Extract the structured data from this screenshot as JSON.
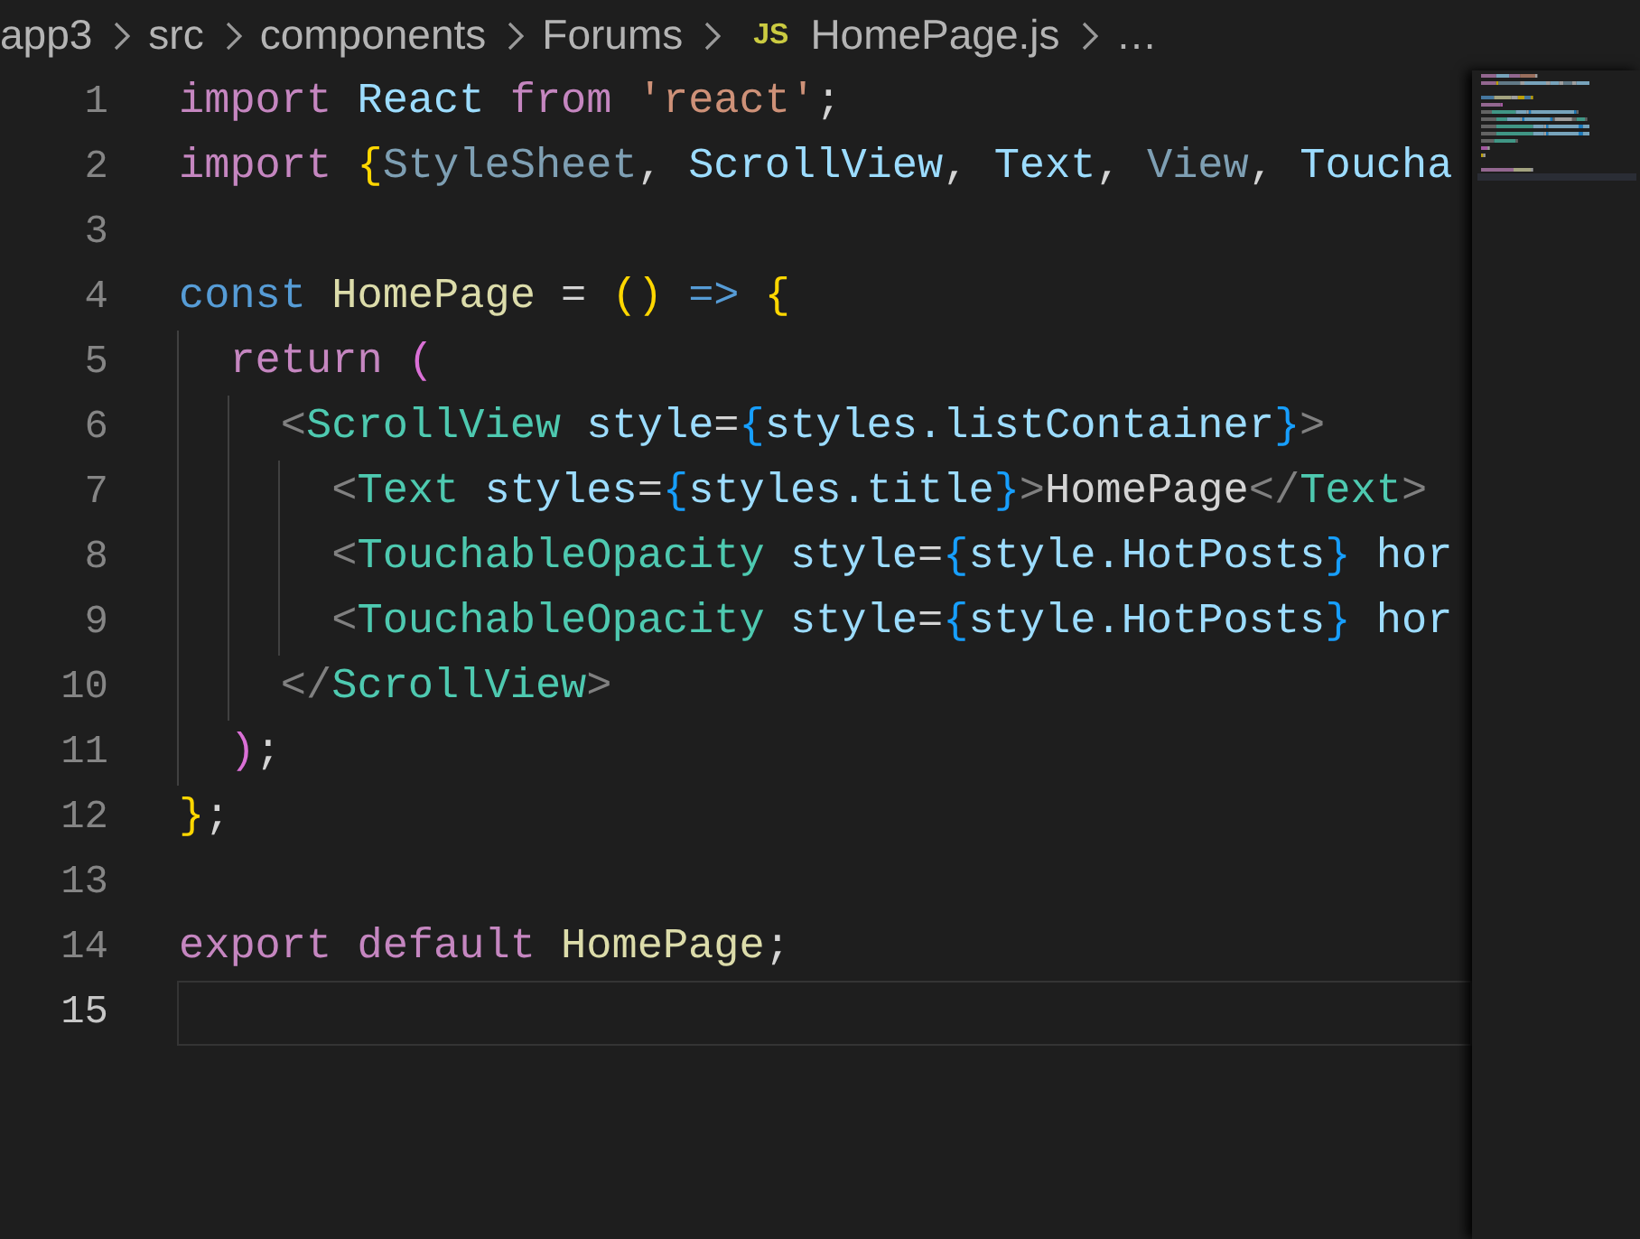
{
  "breadcrumb": [
    {
      "label": "app3"
    },
    {
      "label": "src"
    },
    {
      "label": "components"
    },
    {
      "label": "Forums"
    },
    {
      "label": "HomePage.js",
      "file_badge": "JS"
    },
    {
      "label": "…"
    }
  ],
  "lines": [
    {
      "number": "1",
      "current": false,
      "tokens": [
        {
          "kind": "keyword",
          "text": "import "
        },
        {
          "kind": "variable",
          "text": "React "
        },
        {
          "kind": "keyword",
          "text": "from "
        },
        {
          "kind": "string",
          "text": "'react'"
        },
        {
          "kind": "plain",
          "text": ";"
        }
      ]
    },
    {
      "number": "2",
      "current": false,
      "tokens": [
        {
          "kind": "keyword",
          "text": "import "
        },
        {
          "kind": "brace1",
          "text": "{"
        },
        {
          "kind": "unused",
          "text": "StyleSheet"
        },
        {
          "kind": "plain",
          "text": ", "
        },
        {
          "kind": "variable",
          "text": "ScrollView"
        },
        {
          "kind": "plain",
          "text": ", "
        },
        {
          "kind": "variable",
          "text": "Text"
        },
        {
          "kind": "plain",
          "text": ", "
        },
        {
          "kind": "unused",
          "text": "View"
        },
        {
          "kind": "plain",
          "text": ", "
        },
        {
          "kind": "variable",
          "text": "Toucha"
        }
      ]
    },
    {
      "number": "3",
      "current": false
    },
    {
      "number": "4",
      "current": false,
      "tokens": [
        {
          "kind": "storage",
          "text": "const "
        },
        {
          "kind": "function",
          "text": "HomePage"
        },
        {
          "kind": "plain",
          "text": " = "
        },
        {
          "kind": "brace1",
          "text": "() "
        },
        {
          "kind": "storage",
          "text": "=> "
        },
        {
          "kind": "brace1",
          "text": "{"
        }
      ]
    },
    {
      "number": "5",
      "current": false,
      "tokens": [
        {
          "kind": "keyword",
          "text": "  return "
        },
        {
          "kind": "brace2",
          "text": "("
        }
      ]
    },
    {
      "number": "6",
      "current": false,
      "tokens": [
        {
          "kind": "angle",
          "text": "    <"
        },
        {
          "kind": "tag",
          "text": "ScrollView "
        },
        {
          "kind": "variable",
          "text": "style"
        },
        {
          "kind": "plain",
          "text": "="
        },
        {
          "kind": "brace3",
          "text": "{"
        },
        {
          "kind": "variable",
          "text": "styles.listContainer"
        },
        {
          "kind": "brace3",
          "text": "}"
        },
        {
          "kind": "angle",
          "text": ">"
        }
      ]
    },
    {
      "number": "7",
      "current": false,
      "tokens": [
        {
          "kind": "angle",
          "text": "      <"
        },
        {
          "kind": "tag",
          "text": "Text "
        },
        {
          "kind": "variable",
          "text": "styles"
        },
        {
          "kind": "plain",
          "text": "="
        },
        {
          "kind": "brace3",
          "text": "{"
        },
        {
          "kind": "variable",
          "text": "styles.title"
        },
        {
          "kind": "brace3",
          "text": "}"
        },
        {
          "kind": "angle",
          "text": ">"
        },
        {
          "kind": "plain",
          "text": "HomePage"
        },
        {
          "kind": "angle",
          "text": "</"
        },
        {
          "kind": "tag",
          "text": "Text"
        },
        {
          "kind": "angle",
          "text": ">"
        }
      ]
    },
    {
      "number": "8",
      "current": false,
      "tokens": [
        {
          "kind": "angle",
          "text": "      <"
        },
        {
          "kind": "tag",
          "text": "TouchableOpacity "
        },
        {
          "kind": "variable",
          "text": "style"
        },
        {
          "kind": "plain",
          "text": "="
        },
        {
          "kind": "brace3",
          "text": "{"
        },
        {
          "kind": "variable",
          "text": "style.HotPosts"
        },
        {
          "kind": "brace3",
          "text": "} "
        },
        {
          "kind": "variable",
          "text": "hor"
        }
      ]
    },
    {
      "number": "9",
      "current": false,
      "tokens": [
        {
          "kind": "angle",
          "text": "      <"
        },
        {
          "kind": "tag",
          "text": "TouchableOpacity "
        },
        {
          "kind": "variable",
          "text": "style"
        },
        {
          "kind": "plain",
          "text": "="
        },
        {
          "kind": "brace3",
          "text": "{"
        },
        {
          "kind": "variable",
          "text": "style.HotPosts"
        },
        {
          "kind": "brace3",
          "text": "} "
        },
        {
          "kind": "variable",
          "text": "hor"
        }
      ]
    },
    {
      "number": "10",
      "current": false,
      "tokens": [
        {
          "kind": "angle",
          "text": "    </"
        },
        {
          "kind": "tag",
          "text": "ScrollView"
        },
        {
          "kind": "angle",
          "text": ">"
        }
      ]
    },
    {
      "number": "11",
      "current": false,
      "tokens": [
        {
          "kind": "brace2",
          "text": "  )"
        },
        {
          "kind": "plain",
          "text": ";"
        }
      ]
    },
    {
      "number": "12",
      "current": false,
      "tokens": [
        {
          "kind": "brace1",
          "text": "}"
        },
        {
          "kind": "plain",
          "text": ";"
        }
      ]
    },
    {
      "number": "13",
      "current": false
    },
    {
      "number": "14",
      "current": false,
      "tokens": [
        {
          "kind": "keyword",
          "text": "export default "
        },
        {
          "kind": "function",
          "text": "HomePage"
        },
        {
          "kind": "plain",
          "text": ";"
        }
      ]
    },
    {
      "number": "15",
      "current": true
    }
  ]
}
